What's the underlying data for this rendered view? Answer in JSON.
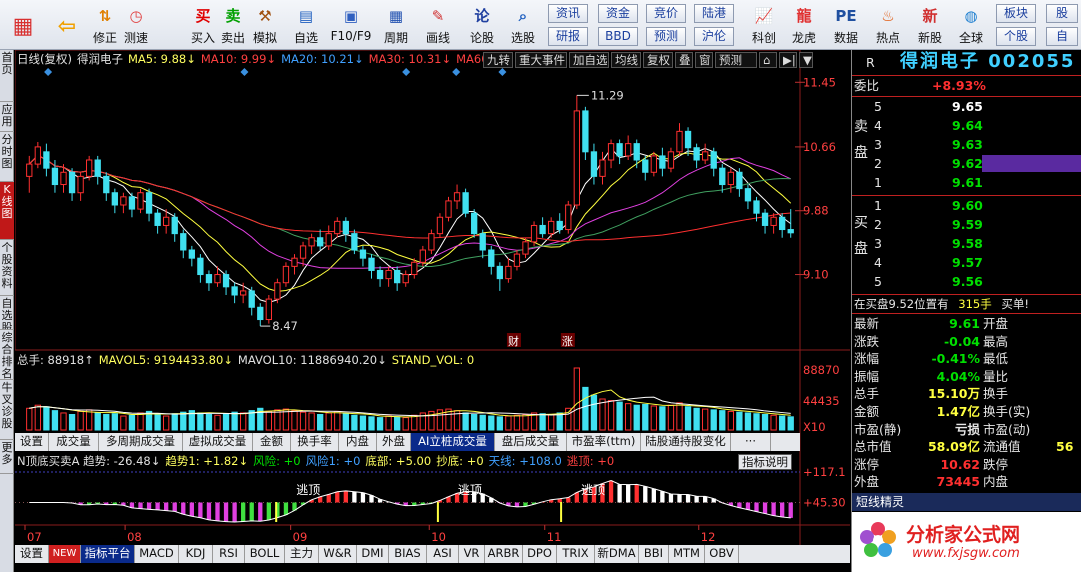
{
  "toolbar": {
    "buttons": [
      {
        "label": "",
        "icon": "grid-icon",
        "color": "#d83030"
      },
      {
        "label": "",
        "icon": "back-arrow-icon",
        "color": "#f0a000"
      },
      {
        "label": "修正",
        "icon": "arrows-updown-icon",
        "color": "#e08000"
      },
      {
        "label": "测速",
        "icon": "clock-icon",
        "color": "#e04040"
      },
      {
        "label": "买入",
        "icon": "buy-icon",
        "color": "#e00000"
      },
      {
        "label": "卖出",
        "icon": "sell-icon",
        "color": "#00a000"
      },
      {
        "label": "模拟",
        "icon": "hammer-icon",
        "color": "#a05010"
      },
      {
        "label": "自选",
        "icon": "folder-icon",
        "color": "#2060c0"
      },
      {
        "label": "F10/F9",
        "icon": "f10-icon",
        "color": "#3060c0"
      },
      {
        "label": "周期",
        "icon": "calendar-icon",
        "color": "#2050b0"
      },
      {
        "label": "画线",
        "icon": "pencil-icon",
        "color": "#d03030"
      },
      {
        "label": "论股",
        "icon": "discuss-icon",
        "color": "#2040a0"
      },
      {
        "label": "选股",
        "icon": "magnifier-icon",
        "color": "#2060c0"
      },
      {
        "label": "科创",
        "icon": "chart-icon",
        "color": "#e08000"
      },
      {
        "label": "龙虎",
        "icon": "dragon-icon",
        "color": "#e03030"
      },
      {
        "label": "数据",
        "icon": "pe-icon",
        "color": "#2050a0"
      },
      {
        "label": "热点",
        "icon": "fire-icon",
        "color": "#e05000"
      },
      {
        "label": "新股",
        "icon": "new-icon",
        "color": "#d03030"
      },
      {
        "label": "全球",
        "icon": "globe-icon",
        "color": "#2080d0"
      }
    ],
    "small_buttons": [
      "资讯",
      "资金",
      "竞价",
      "陆港",
      "研报",
      "BBD",
      "预测",
      "沪伦",
      "板块",
      "股",
      "个股",
      "自"
    ],
    "pe_label": "PE"
  },
  "leftnav": [
    "首页",
    "应用",
    "分时图",
    "K线图",
    "个股资料",
    "自选股",
    "综合排名",
    "牛叉诊股",
    "更多"
  ],
  "chart": {
    "legend_main": [
      {
        "text": "日线(复权)",
        "color": "#e0e0e0"
      },
      {
        "text": "得润电子",
        "color": "#e0e0e0"
      },
      {
        "text": "MA5: 9.88↓",
        "color": "#ffff60"
      },
      {
        "text": "MA10: 9.99↓",
        "color": "#ff4040"
      },
      {
        "text": "MA20: 10.21↓",
        "color": "#40a0ff"
      },
      {
        "text": "MA30: 10.31↓",
        "color": "#ff4040"
      },
      {
        "text": "MA60:",
        "color": "#ff4040"
      }
    ],
    "top_buttons": [
      "九转",
      "重大事件",
      "加自选",
      "均线",
      "复权",
      "叠",
      "窗",
      "预测",
      "⌂",
      "▶|",
      "▼"
    ],
    "price_ticks": [
      "11.45",
      "10.66",
      "9.88",
      "9.10"
    ],
    "annot_high": "11.29",
    "annot_low": "8.47",
    "markers": [
      "财",
      "涨"
    ],
    "legend_vol": [
      {
        "text": "总手: 88918↑",
        "color": "#e0e0e0"
      },
      {
        "text": "MAVOL5: 9194433.80↓",
        "color": "#ffff60"
      },
      {
        "text": "MAVOL10: 11886940.20↓",
        "color": "#e0e0e0"
      },
      {
        "text": "STAND_VOL: 0",
        "color": "#ffff60"
      }
    ],
    "vol_ticks": [
      "88870",
      "44435",
      "X10"
    ],
    "tabs1": [
      "设置",
      "成交量",
      "多周期成交量",
      "虚拟成交量",
      "金额",
      "换手率",
      "内盘",
      "外盘",
      "AI立桩成交量",
      "盘后成交量",
      "市盈率(ttm)",
      "陆股通持股变化",
      "···"
    ],
    "legend_ind": [
      {
        "text": "N顶底买卖A 趋势: -26.48↓",
        "color": "#e0e0e0"
      },
      {
        "text": "趋势1: +1.82↓",
        "color": "#ffff60"
      },
      {
        "text": "风险: +0",
        "color": "#00e000"
      },
      {
        "text": "风险1: +0",
        "color": "#40a0ff"
      },
      {
        "text": "底部: +5.00",
        "color": "#ffff60"
      },
      {
        "text": "抄底: +0",
        "color": "#ffff60"
      },
      {
        "text": "天线: +108.0",
        "color": "#40a0ff"
      },
      {
        "text": "逃顶: +0",
        "color": "#ff4040"
      }
    ],
    "ind_button": "指标说明",
    "ind_ticks": [
      "+117.1",
      "+45.30"
    ],
    "escape_labels": [
      "逃顶",
      "逃顶",
      "逃顶"
    ],
    "month_labels": [
      "07",
      "08",
      "09",
      "10",
      "11",
      "12"
    ],
    "tabs2": [
      "设置",
      "NEW",
      "指标平台",
      "MACD",
      "KDJ",
      "RSI",
      "BOLL",
      "主力",
      "W&R",
      "DMI",
      "BIAS",
      "ASI",
      "VR",
      "ARBR",
      "DPO",
      "TRIX",
      "新DMA",
      "BBI",
      "MTM",
      "OBV"
    ]
  },
  "rightpanel": {
    "header_label": "R",
    "stock_name": "得润电子",
    "stock_code": "002055",
    "weibi_label": "委比",
    "weibi_value": "+8.93%",
    "sell_label": [
      "卖",
      "盘"
    ],
    "buy_label": [
      "买",
      "盘"
    ],
    "sell": [
      {
        "n": "5",
        "p": "9.65"
      },
      {
        "n": "4",
        "p": "9.64"
      },
      {
        "n": "3",
        "p": "9.63"
      },
      {
        "n": "2",
        "p": "9.62"
      },
      {
        "n": "1",
        "p": "9.61"
      }
    ],
    "buy": [
      {
        "n": "1",
        "p": "9.60"
      },
      {
        "n": "2",
        "p": "9.59"
      },
      {
        "n": "3",
        "p": "9.58"
      },
      {
        "n": "4",
        "p": "9.57"
      },
      {
        "n": "5",
        "p": "9.56"
      }
    ],
    "status_line": {
      "left": "在买盘9.52位置有",
      "mid": "315手",
      "right": "买单!"
    },
    "stats": [
      {
        "l": "最新",
        "v": "9.61",
        "vc": "green",
        "r": "开盘"
      },
      {
        "l": "涨跌",
        "v": "-0.04",
        "vc": "green",
        "r": "最高"
      },
      {
        "l": "涨幅",
        "v": "-0.41%",
        "vc": "green",
        "r": "最低"
      },
      {
        "l": "振幅",
        "v": "4.04%",
        "vc": "green",
        "r": "量比"
      },
      {
        "l": "总手",
        "v": "15.10万",
        "vc": "yellow",
        "r": "换手"
      },
      {
        "l": "金额",
        "v": "1.47亿",
        "vc": "yellow",
        "r": "换手(实)"
      },
      {
        "l": "市盈(静)",
        "v": "亏损",
        "vc": "white",
        "r": "市盈(动)"
      },
      {
        "l": "总市值",
        "v": "58.09亿",
        "vc": "yellow",
        "r": "流通值",
        "rv": "56"
      },
      {
        "l": "涨停",
        "v": "10.62",
        "vc": "red",
        "r": "跌停"
      },
      {
        "l": "外盘",
        "v": "73445",
        "vc": "red",
        "r": "内盘"
      }
    ],
    "sprite_title": "短线精灵",
    "watermark_main": "分析家公式网",
    "watermark_url": "www.fxjsgw.com"
  },
  "chart_data": {
    "type": "candlestick",
    "ylim": [
      8.3,
      11.6
    ],
    "candles": [
      [
        10.3,
        10.45,
        10.55,
        10.1
      ],
      [
        10.45,
        10.66,
        10.72,
        10.4
      ],
      [
        10.6,
        10.4,
        10.7,
        10.3
      ],
      [
        10.4,
        10.2,
        10.5,
        10.1
      ],
      [
        10.2,
        10.35,
        10.45,
        10.1
      ],
      [
        10.35,
        10.1,
        10.4,
        10.0
      ],
      [
        10.1,
        10.3,
        10.35,
        10.0
      ],
      [
        10.3,
        10.5,
        10.55,
        10.25
      ],
      [
        10.5,
        10.3,
        10.55,
        10.2
      ],
      [
        10.3,
        10.1,
        10.35,
        10.0
      ],
      [
        10.1,
        9.95,
        10.15,
        9.85
      ],
      [
        9.95,
        10.05,
        10.1,
        9.85
      ],
      [
        10.05,
        9.9,
        10.1,
        9.8
      ],
      [
        9.9,
        10.1,
        10.15,
        9.85
      ],
      [
        10.1,
        9.85,
        10.15,
        9.75
      ],
      [
        9.85,
        9.7,
        9.9,
        9.6
      ],
      [
        9.7,
        9.8,
        9.9,
        9.6
      ],
      [
        9.8,
        9.6,
        9.85,
        9.5
      ],
      [
        9.6,
        9.4,
        9.65,
        9.3
      ],
      [
        9.4,
        9.3,
        9.45,
        9.2
      ],
      [
        9.3,
        9.1,
        9.35,
        9.0
      ],
      [
        9.1,
        9.0,
        9.15,
        8.9
      ],
      [
        9.0,
        9.1,
        9.2,
        8.95
      ],
      [
        9.1,
        8.95,
        9.15,
        8.85
      ],
      [
        8.95,
        8.85,
        9.0,
        8.75
      ],
      [
        8.85,
        8.9,
        9.0,
        8.75
      ],
      [
        8.9,
        8.7,
        8.95,
        8.6
      ],
      [
        8.7,
        8.55,
        8.75,
        8.47
      ],
      [
        8.55,
        8.8,
        8.85,
        8.5
      ],
      [
        8.8,
        9.0,
        9.05,
        8.75
      ],
      [
        9.0,
        9.2,
        9.25,
        8.95
      ],
      [
        9.2,
        9.3,
        9.35,
        9.1
      ],
      [
        9.3,
        9.45,
        9.5,
        9.2
      ],
      [
        9.45,
        9.55,
        9.6,
        9.35
      ],
      [
        9.55,
        9.45,
        9.65,
        9.4
      ],
      [
        9.45,
        9.6,
        9.7,
        9.4
      ],
      [
        9.6,
        9.75,
        9.8,
        9.55
      ],
      [
        9.75,
        9.6,
        9.8,
        9.5
      ],
      [
        9.6,
        9.4,
        9.65,
        9.35
      ],
      [
        9.4,
        9.3,
        9.45,
        9.2
      ],
      [
        9.3,
        9.15,
        9.35,
        9.05
      ],
      [
        9.15,
        9.05,
        9.2,
        8.95
      ],
      [
        9.05,
        9.15,
        9.2,
        8.95
      ],
      [
        9.15,
        9.0,
        9.2,
        8.9
      ],
      [
        9.0,
        9.1,
        9.15,
        8.95
      ],
      [
        9.1,
        9.25,
        9.3,
        9.05
      ],
      [
        9.25,
        9.4,
        9.45,
        9.2
      ],
      [
        9.4,
        9.6,
        9.65,
        9.35
      ],
      [
        9.6,
        9.8,
        9.85,
        9.55
      ],
      [
        9.8,
        10.0,
        10.05,
        9.75
      ],
      [
        10.0,
        10.1,
        10.2,
        9.9
      ],
      [
        10.1,
        9.85,
        10.15,
        9.8
      ],
      [
        9.85,
        9.6,
        9.9,
        9.55
      ],
      [
        9.6,
        9.4,
        9.65,
        9.3
      ],
      [
        9.4,
        9.2,
        9.45,
        9.1
      ],
      [
        9.2,
        9.05,
        9.25,
        8.9
      ],
      [
        9.05,
        9.2,
        9.3,
        9.0
      ],
      [
        9.2,
        9.35,
        9.4,
        9.15
      ],
      [
        9.35,
        9.5,
        9.55,
        9.3
      ],
      [
        9.5,
        9.7,
        9.75,
        9.45
      ],
      [
        9.7,
        9.6,
        9.8,
        9.55
      ],
      [
        9.6,
        9.75,
        9.8,
        9.55
      ],
      [
        9.75,
        9.65,
        9.85,
        9.6
      ],
      [
        9.65,
        9.95,
        10.0,
        9.6
      ],
      [
        9.95,
        11.1,
        11.29,
        9.9
      ],
      [
        11.1,
        10.6,
        11.15,
        10.5
      ],
      [
        10.6,
        10.3,
        10.7,
        10.2
      ],
      [
        10.3,
        10.5,
        10.6,
        10.2
      ],
      [
        10.5,
        10.7,
        10.75,
        10.4
      ],
      [
        10.7,
        10.55,
        10.75,
        10.45
      ],
      [
        10.55,
        10.7,
        10.8,
        10.5
      ],
      [
        10.7,
        10.5,
        10.75,
        10.4
      ],
      [
        10.5,
        10.35,
        10.55,
        10.25
      ],
      [
        10.35,
        10.55,
        10.6,
        10.3
      ],
      [
        10.55,
        10.4,
        10.65,
        10.3
      ],
      [
        10.4,
        10.6,
        10.65,
        10.35
      ],
      [
        10.6,
        10.85,
        10.95,
        10.55
      ],
      [
        10.85,
        10.65,
        10.9,
        10.55
      ],
      [
        10.65,
        10.5,
        10.7,
        10.4
      ],
      [
        10.5,
        10.6,
        10.7,
        10.45
      ],
      [
        10.6,
        10.4,
        10.65,
        10.3
      ],
      [
        10.4,
        10.2,
        10.45,
        10.1
      ],
      [
        10.2,
        10.35,
        10.4,
        10.1
      ],
      [
        10.35,
        10.15,
        10.4,
        10.05
      ],
      [
        10.15,
        10.0,
        10.2,
        9.9
      ],
      [
        10.0,
        9.85,
        10.05,
        9.75
      ],
      [
        9.85,
        9.7,
        9.9,
        9.6
      ],
      [
        9.7,
        9.8,
        9.85,
        9.6
      ],
      [
        9.8,
        9.65,
        9.85,
        9.55
      ],
      [
        9.65,
        9.61,
        9.9,
        9.55
      ]
    ],
    "volume": [
      28,
      32,
      30,
      25,
      22,
      20,
      24,
      26,
      22,
      20,
      21,
      18,
      19,
      22,
      24,
      20,
      18,
      21,
      23,
      25,
      22,
      20,
      19,
      21,
      23,
      22,
      25,
      28,
      24,
      26,
      27,
      25,
      23,
      22,
      20,
      22,
      24,
      21,
      19,
      18,
      17,
      16,
      18,
      17,
      16,
      19,
      22,
      24,
      26,
      27,
      25,
      22,
      20,
      19,
      18,
      17,
      18,
      19,
      20,
      22,
      21,
      20,
      22,
      28,
      80,
      55,
      45,
      40,
      38,
      36,
      34,
      32,
      33,
      31,
      30,
      32,
      35,
      30,
      28,
      27,
      26,
      25,
      24,
      23,
      22,
      21,
      20,
      19,
      18,
      17
    ]
  }
}
